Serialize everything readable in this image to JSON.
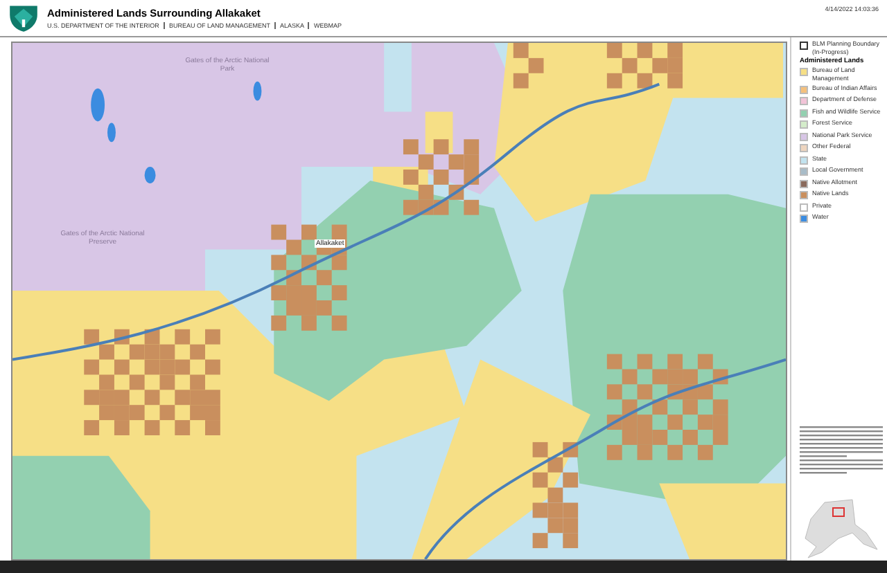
{
  "header": {
    "title": "Administered Lands Surrounding Allakaket",
    "date": "4/14/2022 14:03:36",
    "links": [
      "U.S. DEPARTMENT OF THE INTERIOR",
      "BUREAU OF LAND MANAGEMENT",
      "ALASKA",
      "WEBMAP"
    ]
  },
  "map": {
    "labels": [
      {
        "text": "Gates of the Arctic National Park",
        "kind": "park"
      },
      {
        "text": "Gates of the Arctic National Preserve",
        "kind": "park"
      },
      {
        "text": "Allakaket",
        "kind": "town"
      }
    ]
  },
  "legend": {
    "boundary": "BLM Planning Boundary (In-Progress)",
    "heading": "Administered Lands",
    "items": [
      {
        "label": "Bureau of Land Management",
        "color": "#f6df86"
      },
      {
        "label": "Bureau of Indian Affairs",
        "color": "#f4c07c"
      },
      {
        "label": "Department of Defense",
        "color": "#f2c4d8"
      },
      {
        "label": "Fish and Wildlife Service",
        "color": "#93d0b0"
      },
      {
        "label": "Forest Service",
        "color": "#d4ecca"
      },
      {
        "label": "National Park Service",
        "color": "#d8c6e6"
      },
      {
        "label": "Other Federal",
        "color": "#eed5bf"
      },
      {
        "label": "State",
        "color": "#c3e3ef"
      },
      {
        "label": "Local Government",
        "color": "#a8bcc8"
      },
      {
        "label": "Native Allotment",
        "color": "#8a6a5c"
      },
      {
        "label": "Native Lands",
        "color": "#c98f5e"
      },
      {
        "label": "Private",
        "color": "#ffffff"
      },
      {
        "label": "Water",
        "color": "#3b8ce0"
      }
    ]
  }
}
